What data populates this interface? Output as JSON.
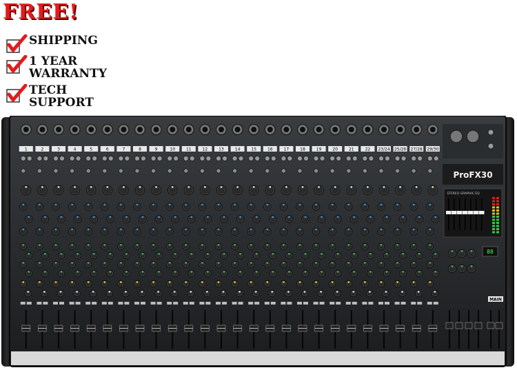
{
  "promo": {
    "headline": "FREE!",
    "items": [
      {
        "lines": [
          "SHIPPING"
        ]
      },
      {
        "lines": [
          "1 YEAR",
          "WARRANTY"
        ]
      },
      {
        "lines": [
          "TECH",
          "SUPPORT"
        ]
      }
    ],
    "accent_color": "#e41b1b"
  },
  "mixer": {
    "channel_labels": [
      "1",
      "2",
      "3",
      "4",
      "5",
      "6",
      "7",
      "8",
      "9",
      "10",
      "11",
      "12",
      "13",
      "14",
      "15",
      "16",
      "17",
      "18",
      "19",
      "20",
      "21",
      "22",
      "23/24",
      "25/26",
      "27/28",
      "29/30"
    ],
    "mono_channels": 22,
    "brand": "ProFX30",
    "main_label": "MAIN",
    "eq_label": "STEREO GRAPHIC EQ",
    "knob_colors": {
      "gain": "#d8d8d8",
      "eq_high": "#3a8fd6",
      "eq_low": "#3a8fd6",
      "aux": "#3fae49",
      "fx": "#f0c419",
      "pan": "#d8d8d8",
      "eq_mid": "#3a8fd6"
    }
  }
}
